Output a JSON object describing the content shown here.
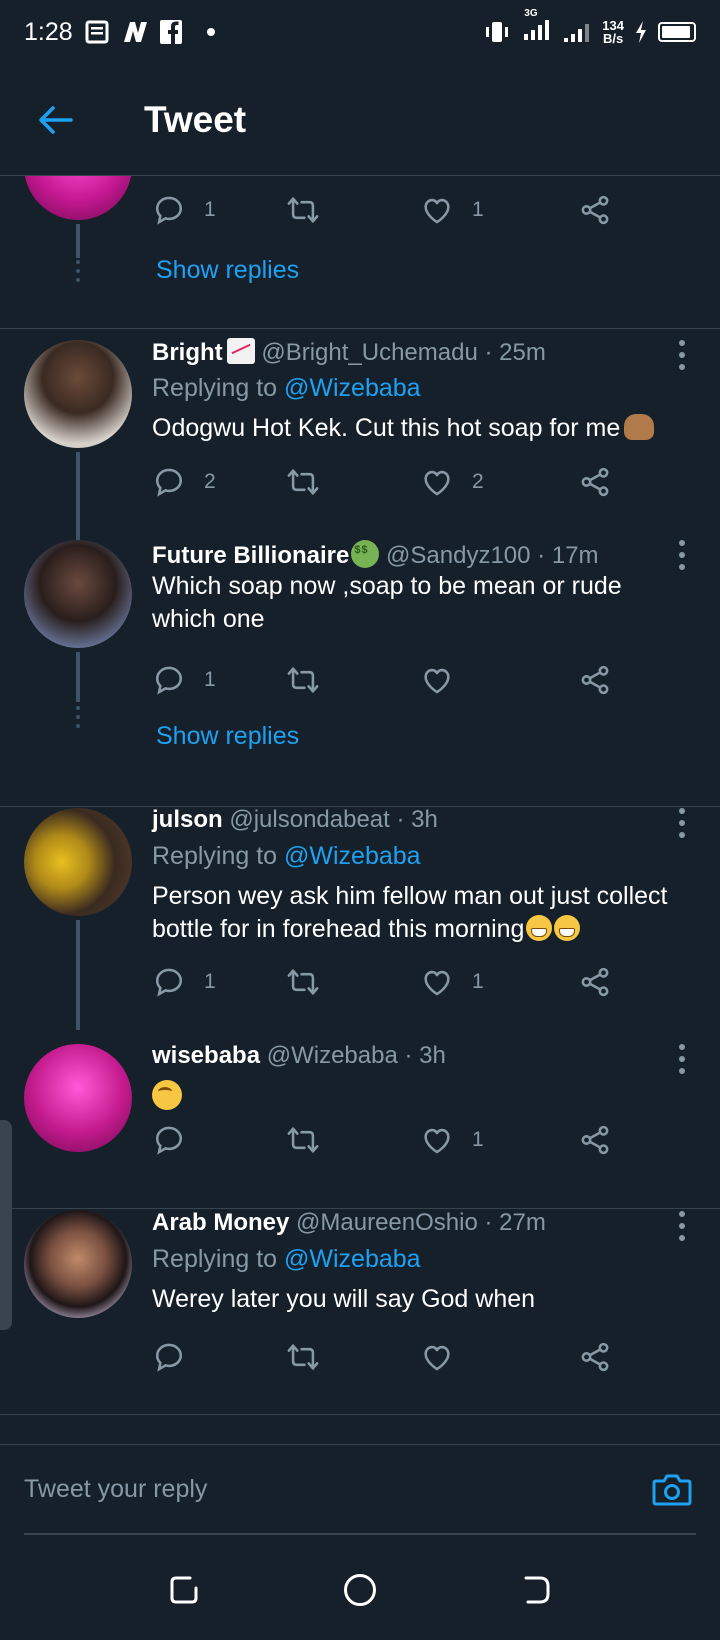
{
  "status_bar": {
    "time": "1:28",
    "network": "3G",
    "speed_value": "134",
    "speed_unit": "B/s"
  },
  "header": {
    "title": "Tweet"
  },
  "feed": {
    "top_partial": {
      "reply_count": "1",
      "like_count": "1",
      "show_replies": "Show replies"
    },
    "tweets": [
      {
        "name": "Bright",
        "handle": "@Bright_Uchemadu",
        "time": "· 25m",
        "replying_prefix": "Replying to",
        "replying_to": "@Wizebaba",
        "text": "Odogwu Hot Kek. Cut this hot soap for me",
        "reply_count": "2",
        "retweet_count": "",
        "like_count": "2"
      },
      {
        "name": "Future Billionaire",
        "handle": "@Sandyz100",
        "time": "· 17m",
        "text": "Which soap now ,soap to be mean or rude which one",
        "reply_count": "1",
        "retweet_count": "",
        "like_count": "",
        "show_replies": "Show replies"
      },
      {
        "name": "julson",
        "handle": "@julsondabeat",
        "time": "· 3h",
        "replying_prefix": "Replying to",
        "replying_to": "@Wizebaba",
        "text": "Person wey ask him fellow man out just collect bottle for in forehead this morning",
        "reply_count": "1",
        "retweet_count": "",
        "like_count": "1"
      },
      {
        "name": "wisebaba",
        "handle": "@Wizebaba",
        "time": "· 3h",
        "text": "",
        "reply_count": "",
        "retweet_count": "",
        "like_count": "1"
      },
      {
        "name": "Arab Money",
        "handle": "@MaureenOshio",
        "time": "· 27m",
        "replying_prefix": "Replying to",
        "replying_to": "@Wizebaba",
        "text": "Werey later you will say God when",
        "reply_count": "",
        "retweet_count": "",
        "like_count": ""
      }
    ]
  },
  "composer": {
    "placeholder": "Tweet your reply"
  },
  "colors": {
    "background": "#15202b",
    "accent": "#1da1f2",
    "muted": "#8899a6",
    "divider": "#38444d"
  },
  "icons": [
    "back-arrow-icon",
    "reply-icon",
    "retweet-icon",
    "like-icon",
    "share-icon",
    "more-icon",
    "camera-icon",
    "recents-icon",
    "home-icon",
    "back-nav-icon"
  ]
}
